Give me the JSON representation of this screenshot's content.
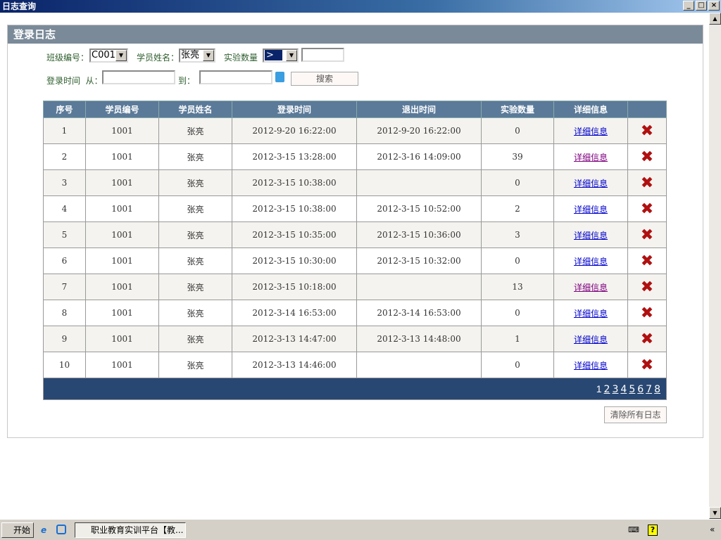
{
  "window": {
    "title": "日志查询",
    "min": "_",
    "max": "□",
    "close": "×"
  },
  "panel": {
    "title": "登录日志"
  },
  "filters": {
    "class_label": "班级编号：",
    "class_value": "C001",
    "name_label": "学员姓名：",
    "name_value": "张亮",
    "count_label": "实验数量",
    "count_op": ">",
    "count_value": "",
    "time_label": "登录时间  从：",
    "time_from": "",
    "to_label": "到：",
    "time_to": "",
    "search": "搜索"
  },
  "table": {
    "headers": [
      "序号",
      "学员编号",
      "学员姓名",
      "登录时间",
      "退出时间",
      "实验数量",
      "详细信息",
      ""
    ],
    "rows": [
      [
        "1",
        "1001",
        "张亮",
        "2012-9-20 16:22:00",
        "2012-9-20 16:22:00",
        "0",
        "详细信息"
      ],
      [
        "2",
        "1001",
        "张亮",
        "2012-3-15 13:28:00",
        "2012-3-16 14:09:00",
        "39",
        "详细信息"
      ],
      [
        "3",
        "1001",
        "张亮",
        "2012-3-15 10:38:00",
        "",
        "0",
        "详细信息"
      ],
      [
        "4",
        "1001",
        "张亮",
        "2012-3-15 10:38:00",
        "2012-3-15 10:52:00",
        "2",
        "详细信息"
      ],
      [
        "5",
        "1001",
        "张亮",
        "2012-3-15 10:35:00",
        "2012-3-15 10:36:00",
        "3",
        "详细信息"
      ],
      [
        "6",
        "1001",
        "张亮",
        "2012-3-15 10:30:00",
        "2012-3-15 10:32:00",
        "0",
        "详细信息"
      ],
      [
        "7",
        "1001",
        "张亮",
        "2012-3-15 10:18:00",
        "",
        "13",
        "详细信息"
      ],
      [
        "8",
        "1001",
        "张亮",
        "2012-3-14 16:53:00",
        "2012-3-14 16:53:00",
        "0",
        "详细信息"
      ],
      [
        "9",
        "1001",
        "张亮",
        "2012-3-13 14:47:00",
        "2012-3-13 14:48:00",
        "1",
        "详细信息"
      ],
      [
        "10",
        "1001",
        "张亮",
        "2012-3-13 14:46:00",
        "",
        "0",
        "详细信息"
      ]
    ],
    "visited": [
      1,
      6
    ],
    "delete_glyph": "✖",
    "pages": [
      "1",
      "2",
      "3",
      "4",
      "5",
      "6",
      "7",
      "8"
    ]
  },
  "clear_all": "清除所有日志",
  "taskbar": {
    "start": "开始",
    "task": "职业教育实训平台【教..."
  }
}
